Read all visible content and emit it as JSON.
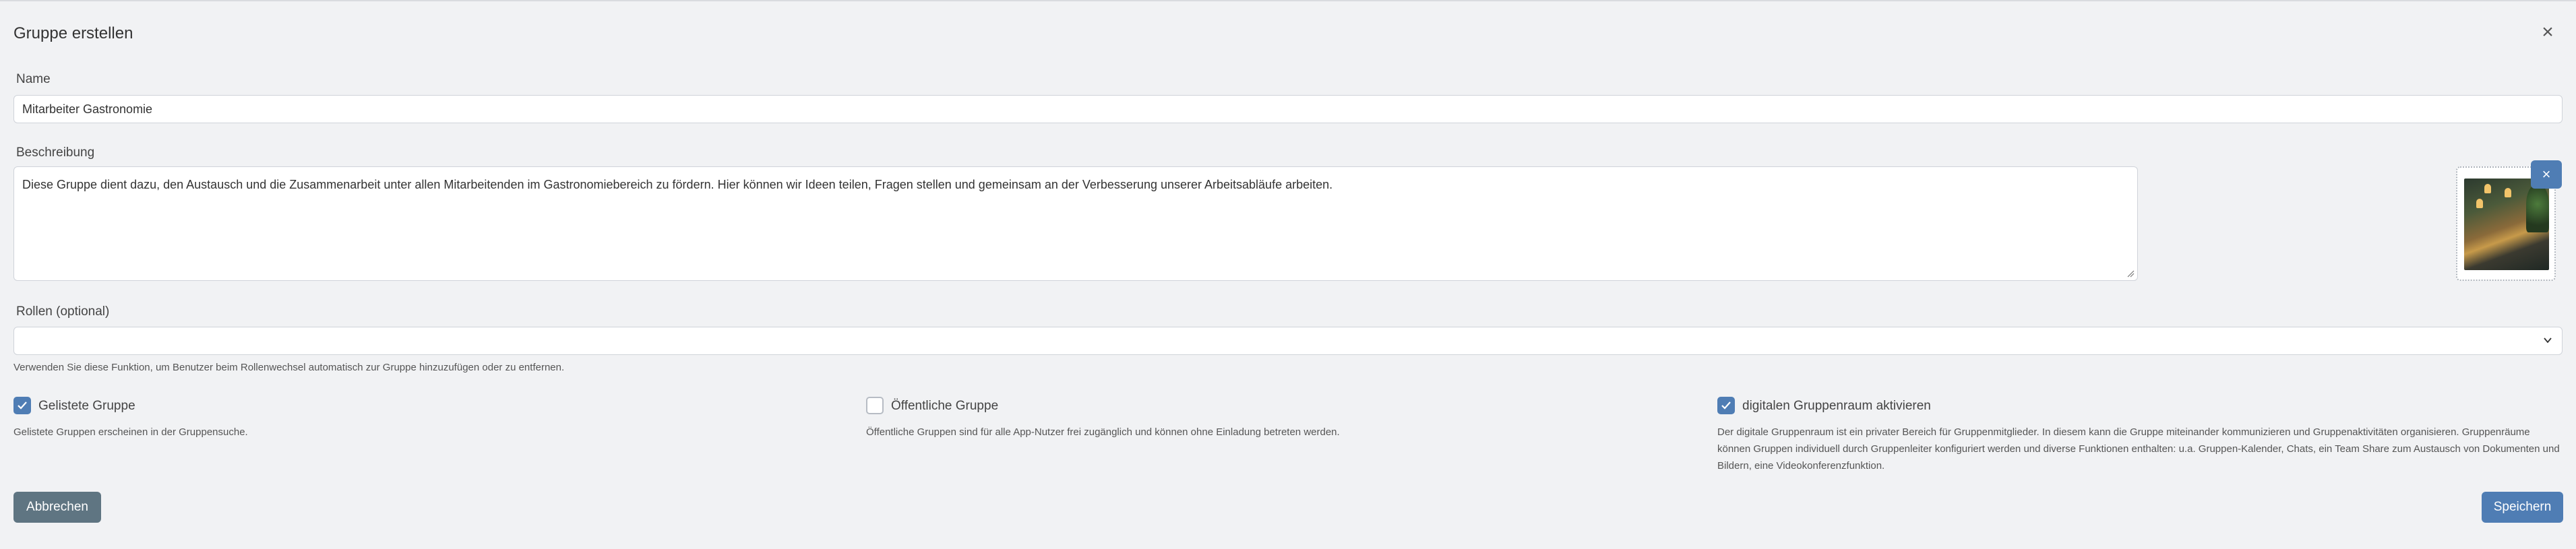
{
  "modal": {
    "title": "Gruppe erstellen"
  },
  "form": {
    "name_label": "Name",
    "name_value": "Mitarbeiter Gastronomie",
    "description_label": "Beschreibung",
    "description_value": "Diese Gruppe dient dazu, den Austausch und die Zusammenarbeit unter allen Mitarbeitenden im Gastronomiebereich zu fördern. Hier können wir Ideen teilen, Fragen stellen und gemeinsam an der Verbesserung unserer Arbeitsabläufe arbeiten.",
    "roles_label": "Rollen (optional)",
    "roles_value": "",
    "roles_help": "Verwenden Sie diese Funktion, um Benutzer beim Rollenwechsel automatisch zur Gruppe hinzuzufügen oder zu entfernen."
  },
  "options": [
    {
      "label": "Gelistete Gruppe",
      "checked": true,
      "description": "Gelistete Gruppen erscheinen in der Gruppensuche."
    },
    {
      "label": "Öffentliche Gruppe",
      "checked": false,
      "description": "Öffentliche Gruppen sind für alle App-Nutzer frei zugänglich und können ohne Einladung betreten werden."
    },
    {
      "label": "digitalen Gruppenraum aktivieren",
      "checked": true,
      "description": "Der digitale Gruppenraum ist ein privater Bereich für Gruppenmitglieder. In diesem kann die Gruppe miteinander kommunizieren und Gruppenaktivitäten organisieren. Gruppenräume können Gruppen individuell durch Gruppenleiter konfiguriert werden und diverse Funktionen enthalten: u.a. Gruppen-Kalender, Chats, ein Team Share zum Austausch von Dokumenten und Bildern, eine Videokonferenzfunktion."
    }
  ],
  "buttons": {
    "cancel": "Abbrechen",
    "save": "Speichern",
    "remove_image": "×",
    "close": "×"
  },
  "icons": {
    "close": "close-icon",
    "remove_image": "close-icon",
    "dropdown": "chevron-down-icon",
    "check": "checkmark-icon"
  },
  "colors": {
    "primary": "#4f7db4",
    "secondary": "#5f7582",
    "background": "#f1f2f4"
  }
}
